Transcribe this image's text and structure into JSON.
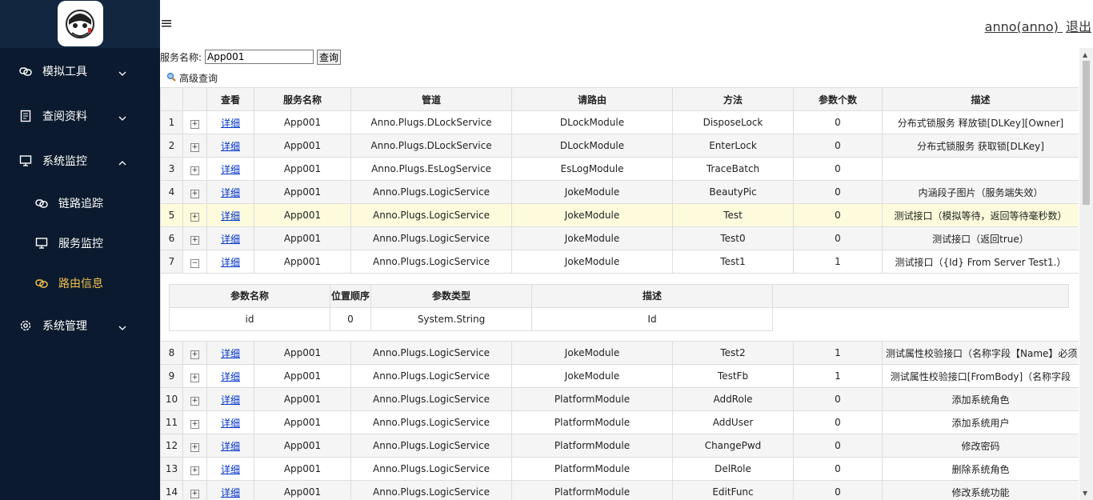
{
  "sidebar": {
    "items": [
      {
        "label": "模拟工具",
        "icon": "link-icon"
      },
      {
        "label": "查阅资料",
        "icon": "document-icon"
      },
      {
        "label": "系统监控",
        "icon": "monitor-icon"
      },
      {
        "label": "系统管理",
        "icon": "gear-icon"
      }
    ],
    "sub_items": [
      {
        "label": "链路追踪",
        "icon": "link-icon"
      },
      {
        "label": "服务监控",
        "icon": "monitor-icon"
      },
      {
        "label": "路由信息",
        "icon": "link-icon"
      }
    ]
  },
  "topbar": {
    "user": "anno(anno)",
    "logout": "退出"
  },
  "search": {
    "label": "服务名称:",
    "value": "App001",
    "button": "查询",
    "advanced": "高级查询"
  },
  "grid": {
    "headers": [
      "",
      "",
      "查看",
      "服务名称",
      "管道",
      "请路由",
      "方法",
      "参数个数",
      "描述"
    ],
    "rows": [
      {
        "n": "1",
        "exp": "+",
        "view": "详细",
        "svc": "App001",
        "pipe": "Anno.Plugs.DLockService",
        "route": "DLockModule",
        "method": "DisposeLock",
        "count": "0",
        "desc": "分布式锁服务 释放锁[DLKey][Owner]"
      },
      {
        "n": "2",
        "exp": "+",
        "view": "详细",
        "svc": "App001",
        "pipe": "Anno.Plugs.DLockService",
        "route": "DLockModule",
        "method": "EnterLock",
        "count": "0",
        "desc": "分布式锁服务 获取锁[DLKey]"
      },
      {
        "n": "3",
        "exp": "+",
        "view": "详细",
        "svc": "App001",
        "pipe": "Anno.Plugs.EsLogService",
        "route": "EsLogModule",
        "method": "TraceBatch",
        "count": "0",
        "desc": ""
      },
      {
        "n": "4",
        "exp": "+",
        "view": "详细",
        "svc": "App001",
        "pipe": "Anno.Plugs.LogicService",
        "route": "JokeModule",
        "method": "BeautyPic",
        "count": "0",
        "desc": "内涵段子图片（服务端失效）"
      },
      {
        "n": "5",
        "exp": "+",
        "view": "详细",
        "svc": "App001",
        "pipe": "Anno.Plugs.LogicService",
        "route": "JokeModule",
        "method": "Test",
        "count": "0",
        "desc": "测试接口（模拟等待，返回等待毫秒数）"
      },
      {
        "n": "6",
        "exp": "+",
        "view": "详细",
        "svc": "App001",
        "pipe": "Anno.Plugs.LogicService",
        "route": "JokeModule",
        "method": "Test0",
        "count": "0",
        "desc": "测试接口（返回true）"
      },
      {
        "n": "7",
        "exp": "−",
        "view": "详细",
        "svc": "App001",
        "pipe": "Anno.Plugs.LogicService",
        "route": "JokeModule",
        "method": "Test1",
        "count": "1",
        "desc": "测试接口（{Id} From Server Test1.）"
      }
    ],
    "rows2": [
      {
        "n": "8",
        "exp": "+",
        "view": "详细",
        "svc": "App001",
        "pipe": "Anno.Plugs.LogicService",
        "route": "JokeModule",
        "method": "Test2",
        "count": "1",
        "desc": "测试属性校验接口（名称字段【Name】必须"
      },
      {
        "n": "9",
        "exp": "+",
        "view": "详细",
        "svc": "App001",
        "pipe": "Anno.Plugs.LogicService",
        "route": "JokeModule",
        "method": "TestFb",
        "count": "1",
        "desc": "测试属性校验接口[FromBody]（名称字段"
      },
      {
        "n": "10",
        "exp": "+",
        "view": "详细",
        "svc": "App001",
        "pipe": "Anno.Plugs.LogicService",
        "route": "PlatformModule",
        "method": "AddRole",
        "count": "0",
        "desc": "添加系统角色"
      },
      {
        "n": "11",
        "exp": "+",
        "view": "详细",
        "svc": "App001",
        "pipe": "Anno.Plugs.LogicService",
        "route": "PlatformModule",
        "method": "AddUser",
        "count": "0",
        "desc": "添加系统用户"
      },
      {
        "n": "12",
        "exp": "+",
        "view": "详细",
        "svc": "App001",
        "pipe": "Anno.Plugs.LogicService",
        "route": "PlatformModule",
        "method": "ChangePwd",
        "count": "0",
        "desc": "修改密码"
      },
      {
        "n": "13",
        "exp": "+",
        "view": "详细",
        "svc": "App001",
        "pipe": "Anno.Plugs.LogicService",
        "route": "PlatformModule",
        "method": "DelRole",
        "count": "0",
        "desc": "删除系统角色"
      },
      {
        "n": "14",
        "exp": "+",
        "view": "详细",
        "svc": "App001",
        "pipe": "Anno.Plugs.LogicService",
        "route": "PlatformModule",
        "method": "EditFunc",
        "count": "0",
        "desc": "修改系统功能"
      }
    ]
  },
  "subgrid": {
    "headers": [
      "参数名称",
      "位置顺序",
      "参数类型",
      "描述",
      ""
    ],
    "rows": [
      {
        "name": "id",
        "pos": "0",
        "type": "System.String",
        "desc": "Id"
      }
    ]
  }
}
